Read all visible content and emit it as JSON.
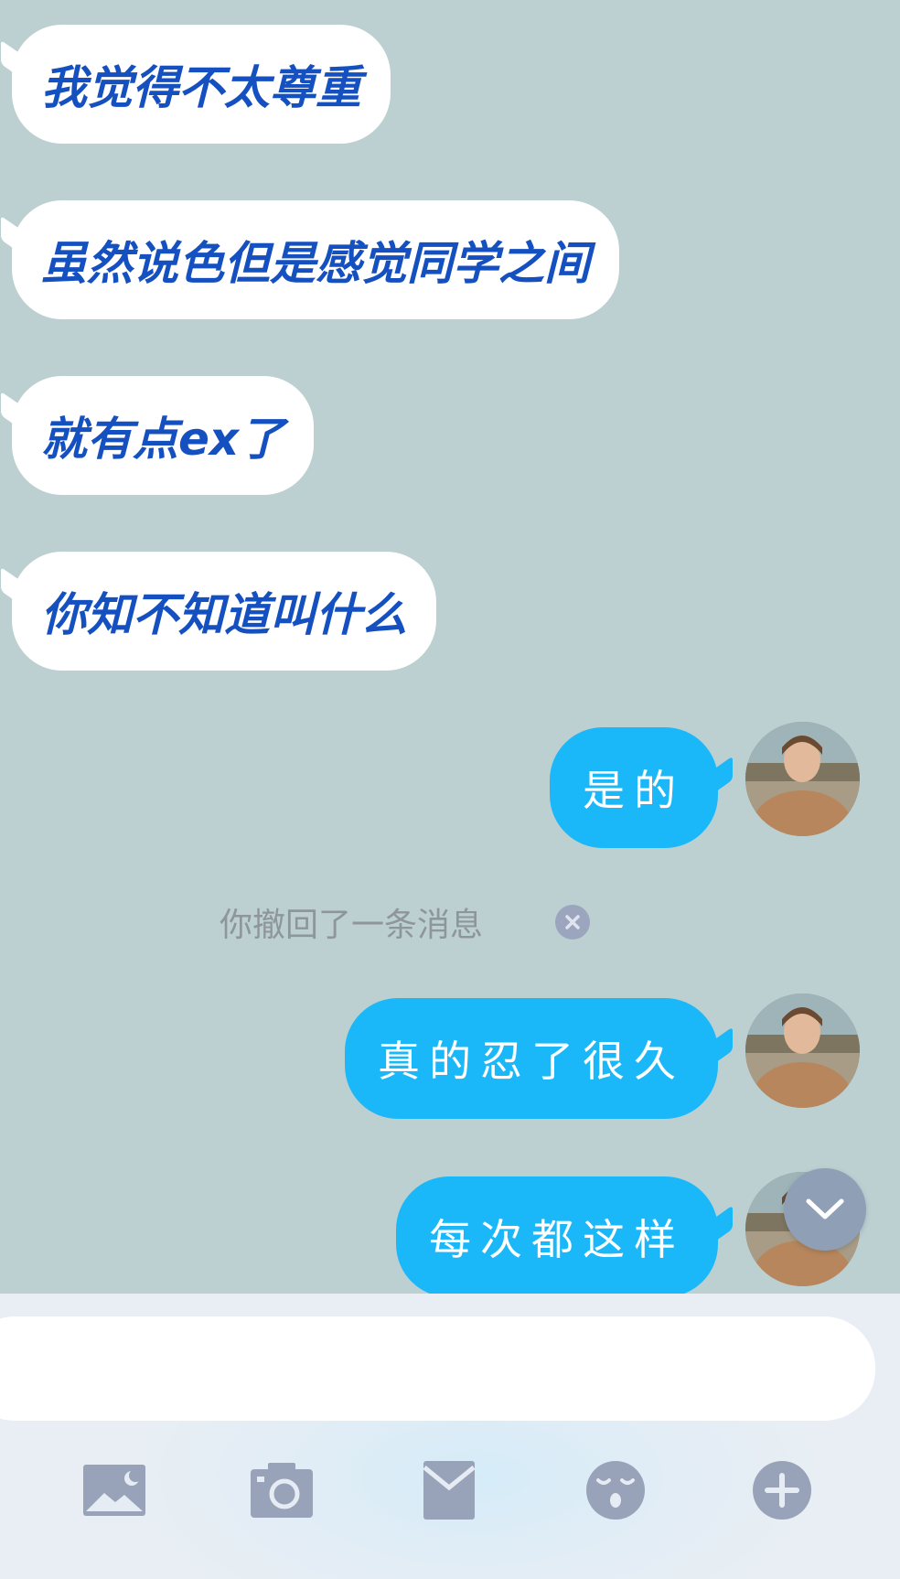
{
  "incoming_messages": [
    {
      "text": "我觉得不太尊重"
    },
    {
      "text": "虽然说色但是感觉同学之间"
    },
    {
      "text": "就有点ex了"
    },
    {
      "text": "你知不知道叫什么"
    }
  ],
  "outgoing_messages": [
    {
      "text": "是的"
    },
    {
      "text": "真的忍了很久"
    },
    {
      "text": "每次都这样"
    }
  ],
  "system_notice": {
    "text": "你撤回了一条消息"
  },
  "input": {
    "value": "",
    "placeholder": ""
  },
  "toolbar": {
    "icons": [
      "image-icon",
      "camera-icon",
      "red-packet-icon",
      "emoji-icon",
      "plus-icon"
    ]
  },
  "colors": {
    "chat_background": "#bcd0d2",
    "incoming_bubble": "#ffffff",
    "incoming_text": "#1550c0",
    "outgoing_bubble": "#1bb8f9",
    "outgoing_text": "#ffffff",
    "toolbar_icon": "#98a2b8"
  }
}
